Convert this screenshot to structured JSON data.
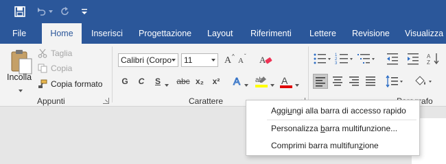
{
  "quick_access": {
    "save_icon": "save-icon",
    "undo_icon": "undo-icon",
    "redo_icon": "redo-icon",
    "customize_icon": "customize-qat-icon"
  },
  "tabs": [
    {
      "label": "File"
    },
    {
      "label": "Home"
    },
    {
      "label": "Inserisci"
    },
    {
      "label": "Progettazione"
    },
    {
      "label": "Layout"
    },
    {
      "label": "Riferimenti"
    },
    {
      "label": "Lettere"
    },
    {
      "label": "Revisione"
    },
    {
      "label": "Visualizza"
    }
  ],
  "active_tab": "Home",
  "clipboard": {
    "group_label": "Appunti",
    "paste_label": "Incolla",
    "cut_label": "Taglia",
    "copy_label": "Copia",
    "format_painter_label": "Copia formato"
  },
  "font": {
    "group_label": "Carattere",
    "font_name": "Calibri (Corpo",
    "font_size": "11",
    "bold": "G",
    "italic": "C",
    "underline": "S",
    "strikethrough": "abc",
    "subscript": "x₂",
    "superscript": "x²",
    "highlight_color": "#ffff00",
    "font_color": "#e00000"
  },
  "paragraph": {
    "group_label": "Paragrafo"
  },
  "context_menu": {
    "items": [
      {
        "pre": "Aggi",
        "key": "u",
        "post": "ngi alla barra di accesso rapido"
      },
      {
        "pre": "Personalizza ",
        "key": "b",
        "post": "arra multifunzione..."
      },
      {
        "pre": "Comprimi barra multifun",
        "key": "z",
        "post": "ione"
      }
    ]
  },
  "colors": {
    "title_bar": "#2b579a",
    "ribbon": "#f3f3f3",
    "document_bg": "#e6e6e6"
  }
}
